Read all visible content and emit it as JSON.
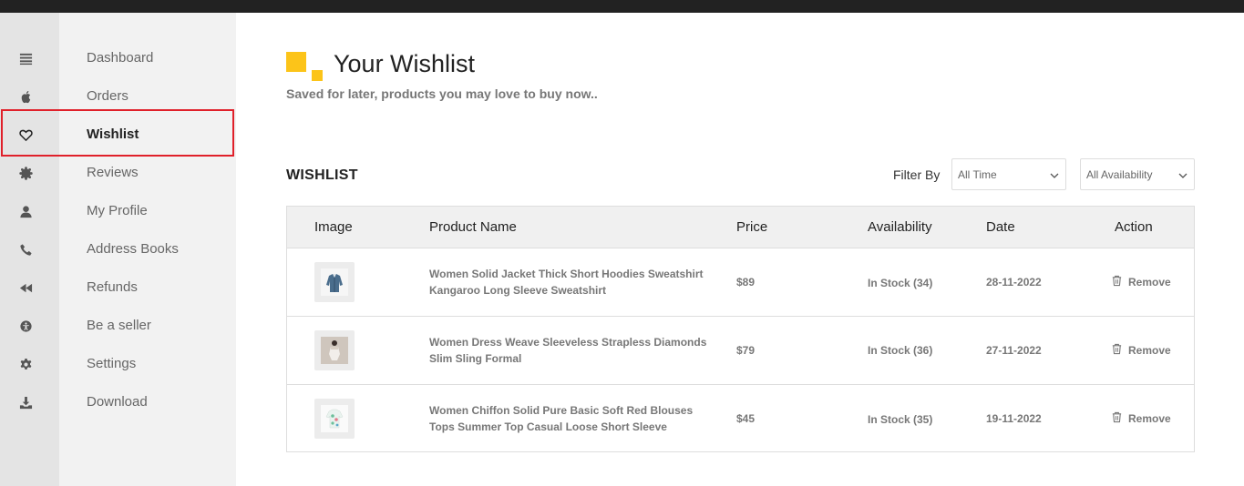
{
  "sidebar": {
    "items": [
      {
        "label": "Dashboard",
        "icon": "list-icon"
      },
      {
        "label": "Orders",
        "icon": "apple-icon"
      },
      {
        "label": "Wishlist",
        "icon": "heart-icon"
      },
      {
        "label": "Reviews",
        "icon": "badge-icon"
      },
      {
        "label": "My Profile",
        "icon": "user-icon"
      },
      {
        "label": "Address Books",
        "icon": "phone-icon"
      },
      {
        "label": "Refunds",
        "icon": "rewind-icon"
      },
      {
        "label": "Be a seller",
        "icon": "accessibility-icon"
      },
      {
        "label": "Settings",
        "icon": "gear-icon"
      },
      {
        "label": "Download",
        "icon": "download-icon"
      }
    ],
    "active": "Wishlist"
  },
  "header": {
    "title": "Your Wishlist",
    "subtitle": "Saved for later, products you may love to buy now.."
  },
  "wishlist": {
    "section_title": "WISHLIST",
    "filter_label": "Filter By",
    "filter_time": "All Time",
    "filter_availability": "All Availability",
    "columns": [
      "Image",
      "Product Name",
      "Price",
      "Availability",
      "Date",
      "Action"
    ],
    "rows": [
      {
        "name": "Women Solid Jacket Thick Short Hoodies Sweatshirt Kangaroo Long Sleeve Sweatshirt",
        "price": "$89",
        "availability": "In Stock (34)",
        "date": "28-11-2022",
        "action": "Remove"
      },
      {
        "name": "Women Dress Weave Sleeveless Strapless Diamonds Slim Sling Formal",
        "price": "$79",
        "availability": "In Stock (36)",
        "date": "27-11-2022",
        "action": "Remove"
      },
      {
        "name": "Women Chiffon Solid Pure Basic Soft Red Blouses Tops Summer Top Casual Loose Short Sleeve",
        "price": "$45",
        "availability": "In Stock (35)",
        "date": "19-11-2022",
        "action": "Remove"
      }
    ]
  },
  "colors": {
    "accent": "#fcc419",
    "highlight_border": "#e0202a",
    "topbar": "#222222"
  }
}
